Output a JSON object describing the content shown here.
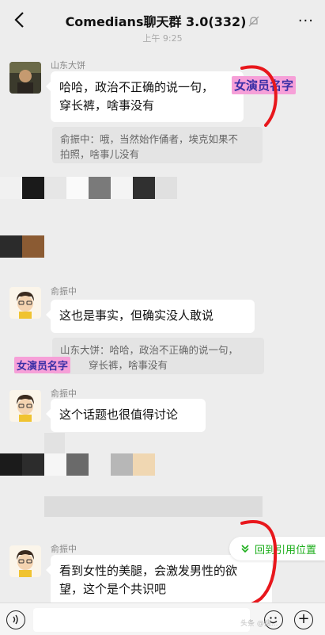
{
  "header": {
    "title": "Comedians聊天群 3.0(332)",
    "more": "···",
    "time": "上午 9:25"
  },
  "messages": [
    {
      "sender": "山东大饼",
      "line1": "哈哈，政治不正确的说一句，",
      "tag": "女演员名字",
      "line2": "穿长裤，啥事没有",
      "quote_line1": "俞振中：哦，当然始作俑者，埃克如果不",
      "quote_line2": "拍照，啥事儿没有"
    },
    {
      "sender": "俞振中",
      "text": "这也是事实，但确实没人敢说",
      "quote_line1": "山东大饼：哈哈，政治不正确的说一句，",
      "quote_tag": "女演员名字",
      "quote_line2": "穿长裤，啥事没有"
    },
    {
      "sender": "俞振中",
      "text": "这个话题也很值得讨论"
    },
    {
      "sender": "俞振中",
      "line1": "看到女性的美腿，会激发男性的欲",
      "line2": "望，这个是个共识吧"
    }
  ],
  "jump_button": {
    "label": "回到引用位置",
    "icon": "double-chevron-down-icon"
  },
  "input_bar": {
    "voice_icon": "voice-icon",
    "emoji_icon": "emoji-icon",
    "plus_icon": "plus-icon",
    "plus_glyph": "+",
    "watermark": "头条 @搜..."
  },
  "colors": {
    "accent_green": "#1aad19",
    "tag_highlight": "#f6a0d8",
    "annotation_red": "#e8171c"
  }
}
